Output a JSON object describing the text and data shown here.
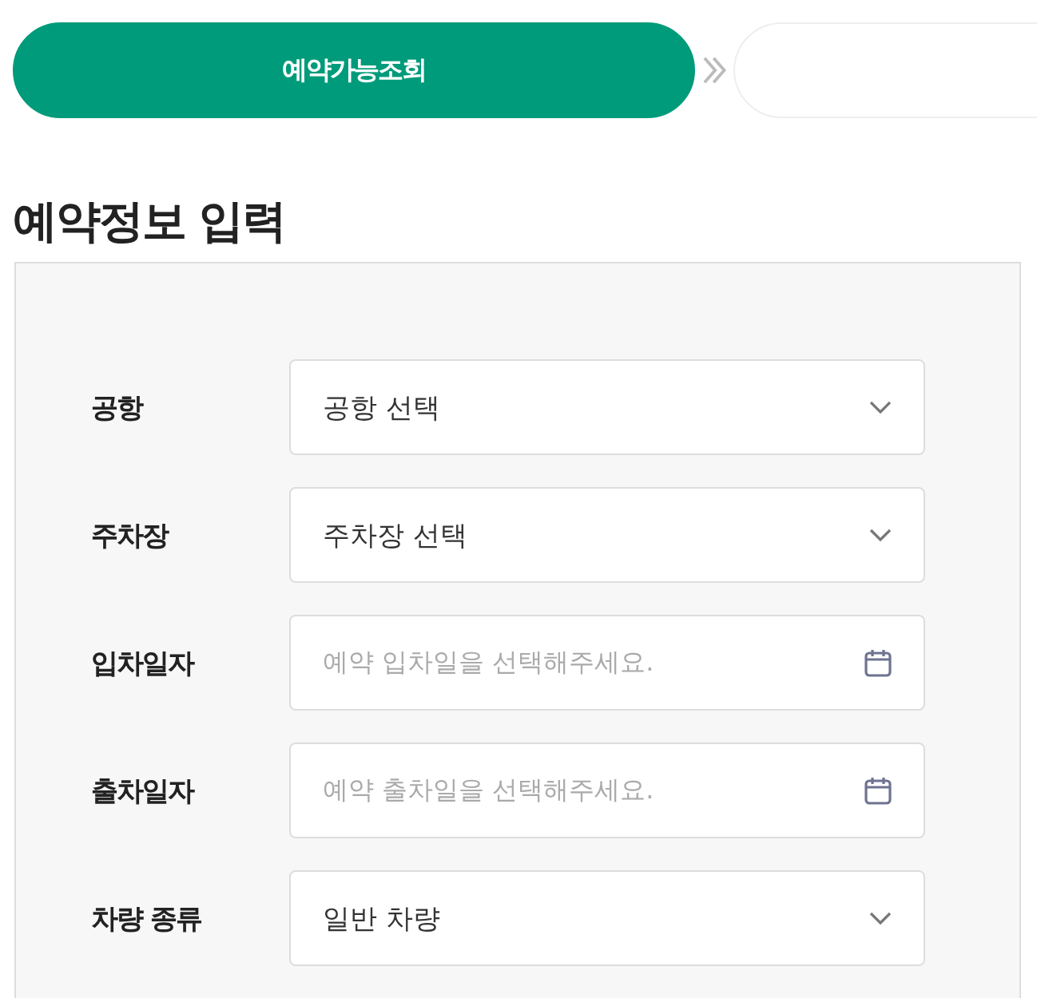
{
  "steps": [
    {
      "label": "예약가능조회",
      "selected": true
    }
  ],
  "heading": "예약정보 입력",
  "fields": [
    {
      "label": "공항",
      "kind": "select",
      "value": "공항 선택"
    },
    {
      "label": "주차장",
      "kind": "select",
      "value": "주차장 선택"
    },
    {
      "label": "입차일자",
      "kind": "date",
      "placeholder": "예약 입차일을 선택해주세요."
    },
    {
      "label": "출차일자",
      "kind": "date",
      "placeholder": "예약 출차일을 선택해주세요."
    },
    {
      "label": "차량 종류",
      "kind": "select",
      "value": "일반 차량"
    }
  ]
}
